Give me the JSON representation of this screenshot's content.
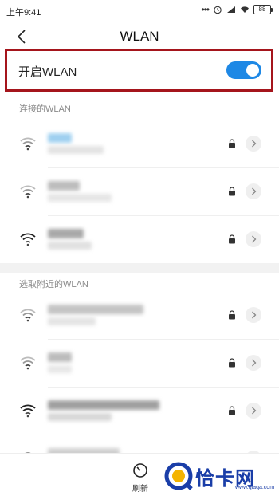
{
  "status_bar": {
    "time": "上午9:41",
    "dots": "•••",
    "battery": "88"
  },
  "header": {
    "title": "WLAN"
  },
  "wlan_toggle": {
    "label": "开启WLAN",
    "enabled": true
  },
  "sections": {
    "connected": "连接的WLAN",
    "nearby": "选取附近的WLAN"
  },
  "connected_networks": [
    {
      "ssid_visible": false,
      "secured": true,
      "signal": "weak"
    },
    {
      "ssid_visible": false,
      "secured": true,
      "signal": "weak"
    },
    {
      "ssid_visible": false,
      "secured": true,
      "signal": "strong"
    }
  ],
  "nearby_networks": [
    {
      "ssid_visible": false,
      "secured": true,
      "signal": "weak"
    },
    {
      "ssid_visible": false,
      "secured": true,
      "signal": "weak"
    },
    {
      "ssid_visible": false,
      "secured": true,
      "signal": "strong"
    },
    {
      "ssid_visible": false,
      "secured": false,
      "signal": "strong"
    }
  ],
  "toolbar": {
    "refresh_label": "刷新"
  },
  "watermark": {
    "text": "恰卡网",
    "url": "www.qiaqa.com"
  },
  "colors": {
    "accent": "#1e88e5",
    "highlight_frame": "#a5151c",
    "watermark": "#1a3ea8"
  }
}
